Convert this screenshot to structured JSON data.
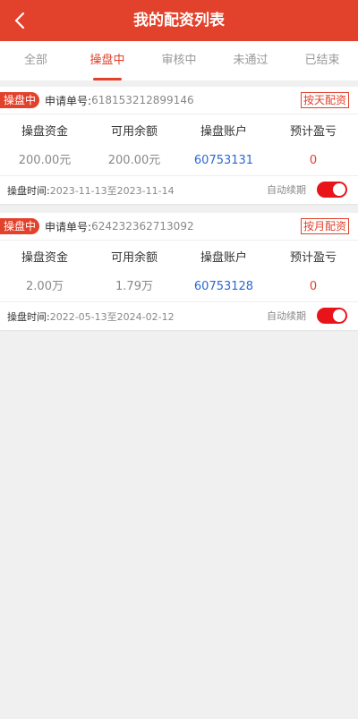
{
  "header": {
    "title": "我的配资列表",
    "back_icon": "chevron-left-icon"
  },
  "tabs": [
    {
      "label": "全部",
      "active": false
    },
    {
      "label": "操盘中",
      "active": true
    },
    {
      "label": "审核中",
      "active": false
    },
    {
      "label": "未通过",
      "active": false
    },
    {
      "label": "已结束",
      "active": false
    }
  ],
  "orders": [
    {
      "status": "操盘中",
      "order_label": "申请单号:",
      "order_no": "618153212899146",
      "type": "按天配资",
      "columns": [
        {
          "label": "操盘资金",
          "value": "200.00元"
        },
        {
          "label": "可用余额",
          "value": "200.00元"
        },
        {
          "label": "操盘账户",
          "value": "60753131"
        },
        {
          "label": "预计盈亏",
          "value": "0"
        }
      ],
      "time_label": "操盘时间:",
      "time_range": "2023-11-13至2023-11-14",
      "renew_label": "自动续期",
      "renew_on": true
    },
    {
      "status": "操盘中",
      "order_label": "申请单号:",
      "order_no": "624232362713092",
      "type": "按月配资",
      "columns": [
        {
          "label": "操盘资金",
          "value": "2.00万"
        },
        {
          "label": "可用余额",
          "value": "1.79万"
        },
        {
          "label": "操盘账户",
          "value": "60753128"
        },
        {
          "label": "预计盈亏",
          "value": "0"
        }
      ],
      "time_label": "操盘时间:",
      "time_range": "2022-05-13至2024-02-12",
      "renew_label": "自动续期",
      "renew_on": true
    }
  ],
  "colors": {
    "accent": "#e2412b",
    "account_blue": "#2b67d1",
    "toggle_on": "#e9141a"
  }
}
